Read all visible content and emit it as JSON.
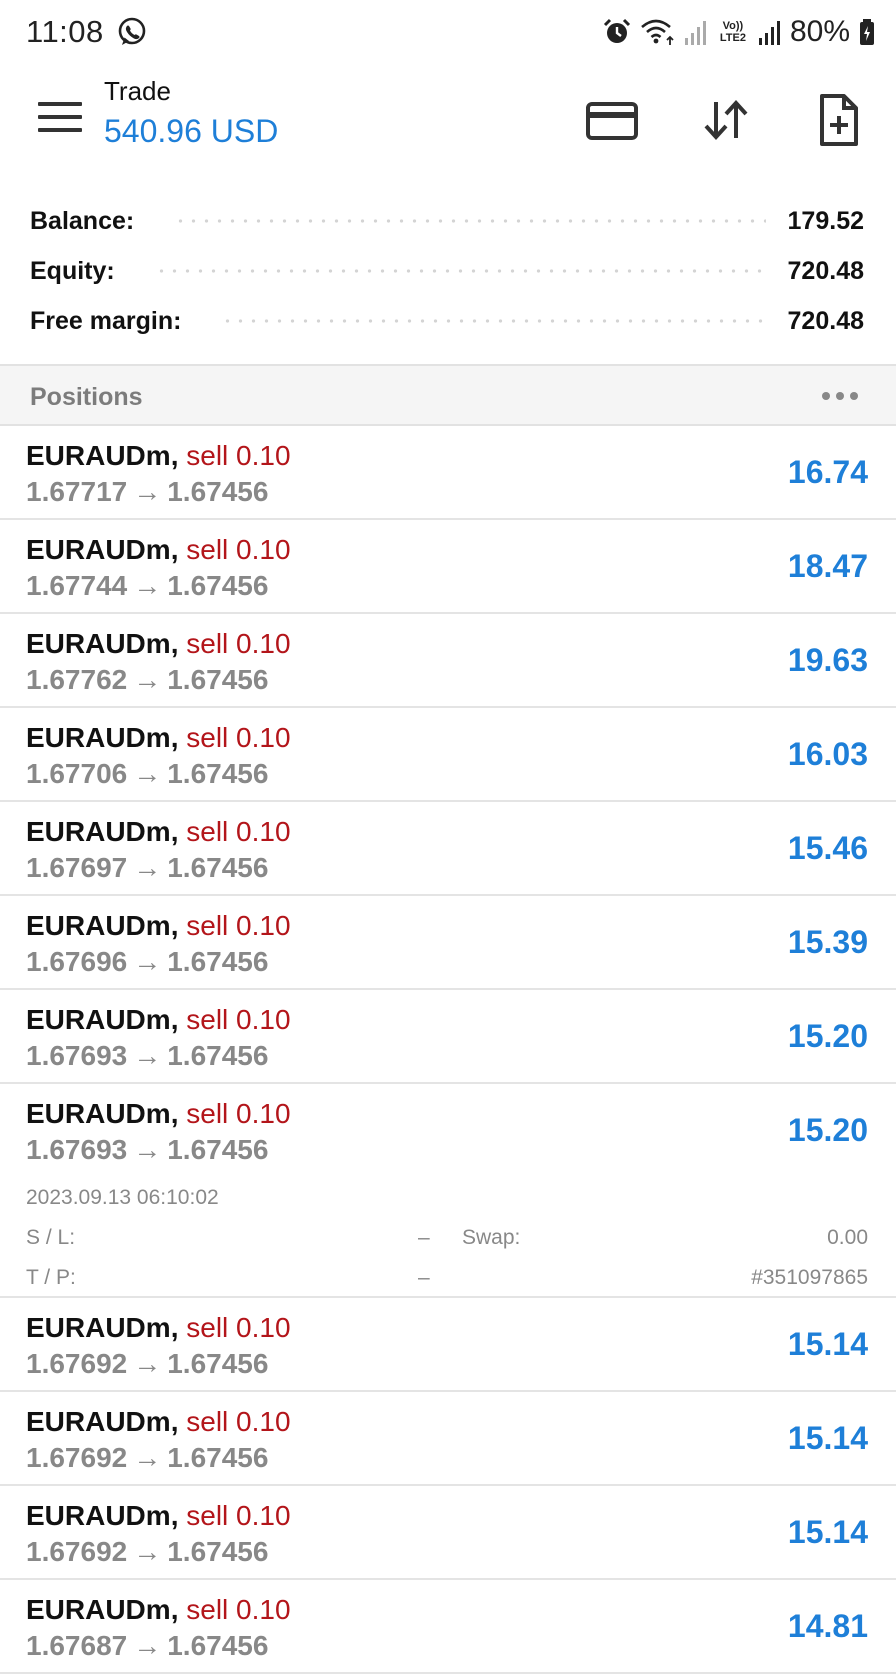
{
  "status_bar": {
    "time": "11:08",
    "battery": "80%",
    "network_label": "Vo)) LTE2",
    "icons": [
      "whatsapp-icon",
      "alarm-icon",
      "wifi-icon",
      "signal-icon",
      "battery-icon"
    ]
  },
  "app_bar": {
    "title": "Trade",
    "subtitle": "540.96 USD",
    "icons": [
      "menu-icon",
      "card-icon",
      "sort-icon",
      "new-order-icon"
    ]
  },
  "summary": {
    "balance_label": "Balance:",
    "balance_value": "179.52",
    "equity_label": "Equity:",
    "equity_value": "720.48",
    "free_margin_label": "Free margin:",
    "free_margin_value": "720.48"
  },
  "positions_header": {
    "title": "Positions"
  },
  "positions": [
    {
      "symbol": "EURAUDm",
      "side": "sell 0.10",
      "open_price": "1.67717",
      "current_price": "1.67456",
      "profit": "16.74"
    },
    {
      "symbol": "EURAUDm",
      "side": "sell 0.10",
      "open_price": "1.67744",
      "current_price": "1.67456",
      "profit": "18.47"
    },
    {
      "symbol": "EURAUDm",
      "side": "sell 0.10",
      "open_price": "1.67762",
      "current_price": "1.67456",
      "profit": "19.63"
    },
    {
      "symbol": "EURAUDm",
      "side": "sell 0.10",
      "open_price": "1.67706",
      "current_price": "1.67456",
      "profit": "16.03"
    },
    {
      "symbol": "EURAUDm",
      "side": "sell 0.10",
      "open_price": "1.67697",
      "current_price": "1.67456",
      "profit": "15.46"
    },
    {
      "symbol": "EURAUDm",
      "side": "sell 0.10",
      "open_price": "1.67696",
      "current_price": "1.67456",
      "profit": "15.39"
    },
    {
      "symbol": "EURAUDm",
      "side": "sell 0.10",
      "open_price": "1.67693",
      "current_price": "1.67456",
      "profit": "15.20"
    },
    {
      "symbol": "EURAUDm",
      "side": "sell 0.10",
      "open_price": "1.67693",
      "current_price": "1.67456",
      "profit": "15.20",
      "details": {
        "time": "2023.09.13 06:10:02",
        "sl_label": "S / L:",
        "sl_value": "–",
        "swap_label": "Swap:",
        "swap_value": "0.00",
        "tp_label": "T / P:",
        "tp_value": "–",
        "ticket": "#351097865"
      }
    },
    {
      "symbol": "EURAUDm",
      "side": "sell 0.10",
      "open_price": "1.67692",
      "current_price": "1.67456",
      "profit": "15.14"
    },
    {
      "symbol": "EURAUDm",
      "side": "sell 0.10",
      "open_price": "1.67692",
      "current_price": "1.67456",
      "profit": "15.14"
    },
    {
      "symbol": "EURAUDm",
      "side": "sell 0.10",
      "open_price": "1.67692",
      "current_price": "1.67456",
      "profit": "15.14"
    },
    {
      "symbol": "EURAUDm",
      "side": "sell 0.10",
      "open_price": "1.67687",
      "current_price": "1.67456",
      "profit": "14.81"
    }
  ],
  "colors": {
    "accent_blue": "#1e7fd8",
    "sell_red": "#b3151a",
    "muted_gray": "#888888"
  }
}
